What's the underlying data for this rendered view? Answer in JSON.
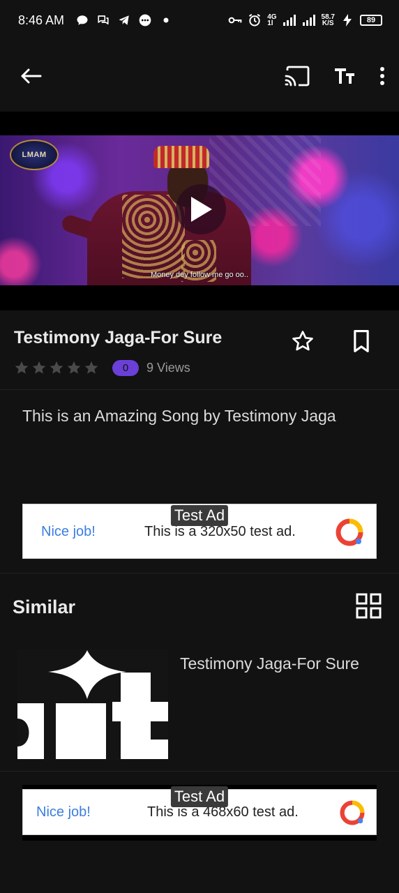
{
  "status_bar": {
    "time": "8:46 AM",
    "net_top": "4G",
    "net_bottom": "1l",
    "speed_top": "58.7",
    "speed_bottom": "K/S",
    "battery": "89"
  },
  "toolbar": {
    "back_icon": "arrow-left-icon",
    "cast_icon": "cast-icon",
    "text_size_icon": "text-size-icon",
    "more_icon": "more-vertical-icon"
  },
  "video": {
    "channel_logo": "LMAM",
    "subtitle": "Money dey follow me go oo..",
    "play_icon": "play-icon"
  },
  "song": {
    "title": "Testimony Jaga-For Sure",
    "rating_stars": 0,
    "rating_max": 5,
    "rating_count": "0",
    "views": "9 Views",
    "description": "This is an Amazing Song by Testimony Jaga"
  },
  "ad_top": {
    "label": "Test Ad",
    "headline": "Nice job!",
    "text": "This is a 320x50 test ad."
  },
  "similar": {
    "heading": "Similar",
    "items": [
      {
        "title": "Testimony Jaga-For Sure"
      }
    ]
  },
  "ad_bottom": {
    "label": "Test Ad",
    "headline": "Nice job!",
    "text": "This is a 468x60 test ad."
  },
  "colors": {
    "background": "#121212",
    "accent": "#6a40d8",
    "ad_link": "#3b7ee1"
  }
}
